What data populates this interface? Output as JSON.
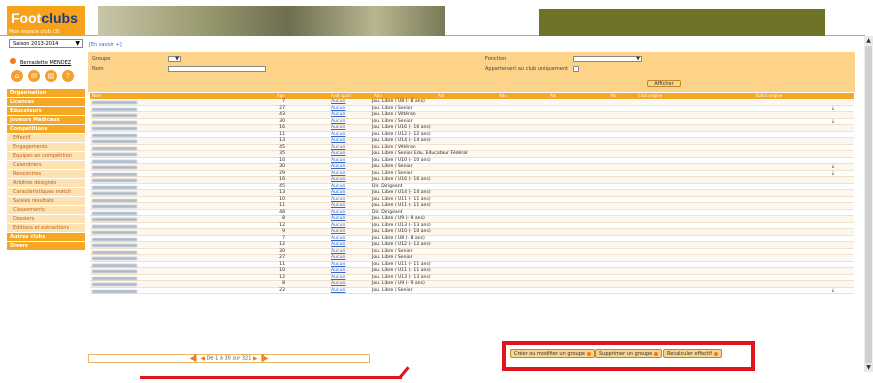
{
  "header": {
    "brand_a": "Foot",
    "brand_b": "clubs",
    "tagline": "Mon espace club (3)"
  },
  "sidebar": {
    "season": "Saison 2013-2014",
    "user": "Bernadette MENDEZ",
    "menu": [
      {
        "label": "Organisation",
        "type": "main"
      },
      {
        "label": "Licences",
        "type": "main"
      },
      {
        "label": "Educateurs",
        "type": "main"
      },
      {
        "label": "Joueurs Médicaux",
        "type": "main"
      },
      {
        "label": "Compétitions",
        "type": "main"
      },
      {
        "label": "Effectif",
        "type": "sub"
      },
      {
        "label": "Engagements",
        "type": "sub"
      },
      {
        "label": "Equipes en compétition",
        "type": "sub"
      },
      {
        "label": "Calendriers",
        "type": "sub"
      },
      {
        "label": "Rencontres",
        "type": "sub"
      },
      {
        "label": "Arbitres désignés",
        "type": "sub"
      },
      {
        "label": "Caractéristiques match",
        "type": "sub"
      },
      {
        "label": "Saisies résultats",
        "type": "sub"
      },
      {
        "label": "Classements",
        "type": "sub"
      },
      {
        "label": "Dossiers",
        "type": "sub"
      },
      {
        "label": "Editions et extractions",
        "type": "sub"
      },
      {
        "label": "Autres clubs",
        "type": "main"
      },
      {
        "label": "Divers",
        "type": "main"
      }
    ]
  },
  "savoir": "[En savoir +]",
  "filters": {
    "groupe": "Groupe",
    "nom": "Nom",
    "fonction": "Fonction",
    "appartenant": "Appartenant au club uniquement",
    "afficher": "Afficher"
  },
  "table": {
    "headers": [
      "Nom",
      "Age",
      "Foot sport",
      "Abu",
      "Abr",
      "Abu",
      "Abi",
      "Abr",
      "Club origine",
      "Statut origine"
    ],
    "rows": [
      {
        "age": "7",
        "fs": "Aucun",
        "sec": "Jou. Libre / U8 (- 8 ans)",
        "dl": ""
      },
      {
        "age": "27",
        "fs": "Aucun",
        "sec": "Jou. Libre / Senior",
        "dl": "⤓"
      },
      {
        "age": "43",
        "fs": "Aucun",
        "sec": "Jou. Libre / Vétéran",
        "dl": ""
      },
      {
        "age": "30",
        "fs": "Aucun",
        "sec": "Jou. Libre / Senior",
        "dl": "⤓"
      },
      {
        "age": "16",
        "fs": "Aucun",
        "sec": "Jou. Libre / U16 (- 16 ans)",
        "dl": ""
      },
      {
        "age": "11",
        "fs": "Aucun",
        "sec": "Jou. Libre / U12 (- 12 ans)",
        "dl": ""
      },
      {
        "age": "13",
        "fs": "Aucun",
        "sec": "Jou. Libre / U14 (- 14 ans)",
        "dl": ""
      },
      {
        "age": "45",
        "fs": "Aucun",
        "sec": "Jou. Libre / Vétéran",
        "dl": ""
      },
      {
        "age": "35",
        "fs": "Aucun",
        "sec": "Jou. Libre / Senior Edu. Educateur Fédéral",
        "dl": ""
      },
      {
        "age": "10",
        "fs": "Aucun",
        "sec": "Jou. Libre / U10 (- 10 ans)",
        "dl": ""
      },
      {
        "age": "30",
        "fs": "Aucun",
        "sec": "Jou. Libre / Senior",
        "dl": "⤓"
      },
      {
        "age": "29",
        "fs": "Aucun",
        "sec": "Jou. Libre / Senior",
        "dl": "⤓"
      },
      {
        "age": "16",
        "fs": "Aucun",
        "sec": "Jou. Libre / U16 (- 16 ans)",
        "dl": ""
      },
      {
        "age": "45",
        "fs": "Aucun",
        "sec": "Dir. Dirigeant",
        "dl": ""
      },
      {
        "age": "13",
        "fs": "Aucun",
        "sec": "Jou. Libre / U14 (- 14 ans)",
        "dl": ""
      },
      {
        "age": "10",
        "fs": "Aucun",
        "sec": "Jou. Libre / U11 (- 11 ans)",
        "dl": ""
      },
      {
        "age": "11",
        "fs": "Aucun",
        "sec": "Jou. Libre / U11 (- 11 ans)",
        "dl": ""
      },
      {
        "age": "48",
        "fs": "Aucun",
        "sec": "Dir. Dirigeant",
        "dl": ""
      },
      {
        "age": "8",
        "fs": "Aucun",
        "sec": "Jou. Libre / U9 (- 9 ans)",
        "dl": ""
      },
      {
        "age": "12",
        "fs": "Aucun",
        "sec": "Jou. Libre / U13 (- 13 ans)",
        "dl": ""
      },
      {
        "age": "9",
        "fs": "Aucun",
        "sec": "Jou. Libre / U10 (- 10 ans)",
        "dl": ""
      },
      {
        "age": "7",
        "fs": "Aucun",
        "sec": "Jou. Libre / U8 (- 8 ans)",
        "dl": ""
      },
      {
        "age": "12",
        "fs": "Aucun",
        "sec": "Jou. Libre / U12 (- 12 ans)",
        "dl": ""
      },
      {
        "age": "30",
        "fs": "Aucun",
        "sec": "Jou. Libre / Senior",
        "dl": ""
      },
      {
        "age": "27",
        "fs": "Aucun",
        "sec": "Jou. Libre / Senior",
        "dl": ""
      },
      {
        "age": "11",
        "fs": "Aucun",
        "sec": "Jou. Libre / U11 (- 11 ans)",
        "dl": ""
      },
      {
        "age": "10",
        "fs": "Aucun",
        "sec": "Jou. Libre / U11 (- 11 ans)",
        "dl": ""
      },
      {
        "age": "12",
        "fs": "Aucun",
        "sec": "Jou. Libre / U13 (- 13 ans)",
        "dl": ""
      },
      {
        "age": "8",
        "fs": "Aucun",
        "sec": "Jou. Libre / U9 (- 9 ans)",
        "dl": ""
      },
      {
        "age": "22",
        "fs": "Aucun",
        "sec": "Jou. Libre / Senior",
        "dl": "⤓"
      }
    ]
  },
  "pager": "De 1 à 30 sur 321",
  "actions": {
    "create": "Créer ou modifier un groupe",
    "delete": "Supprimer un groupe",
    "recalc": "Recalculer effectif"
  }
}
